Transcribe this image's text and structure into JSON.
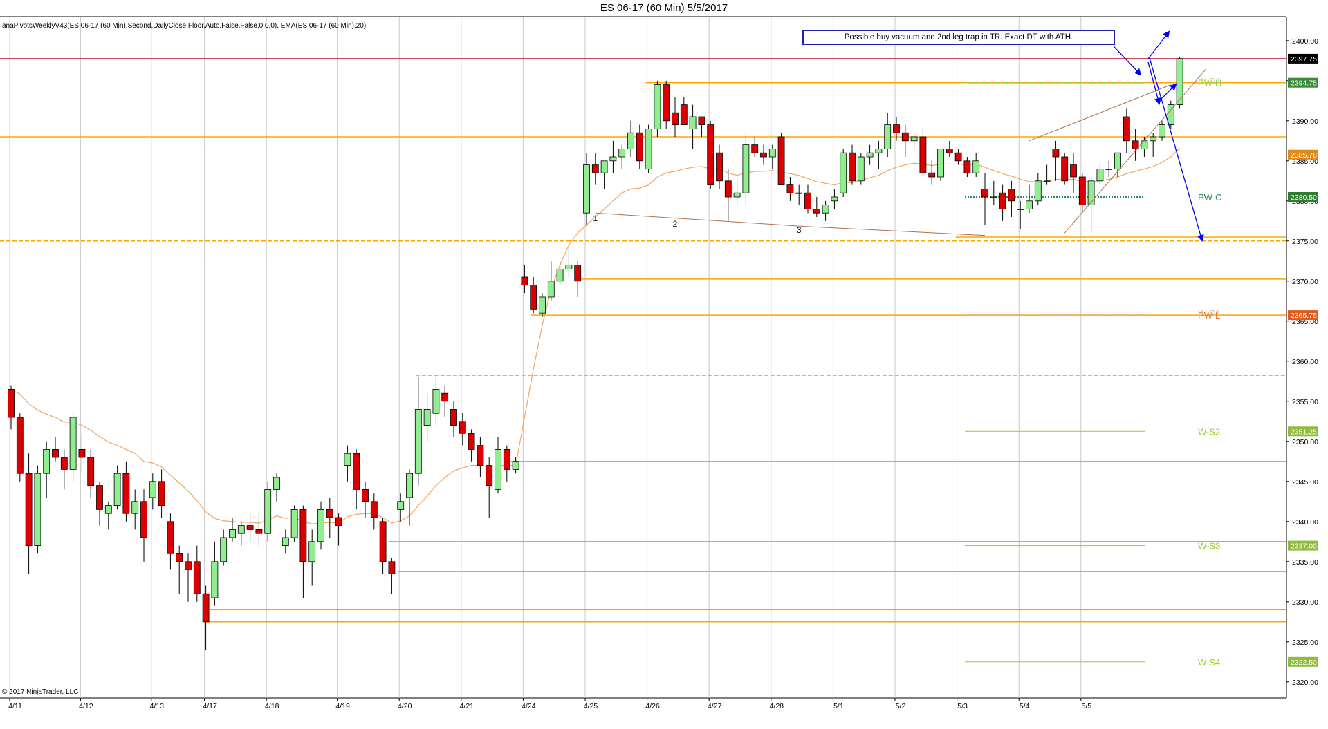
{
  "header": {
    "title": "ES 06-17 (60 Min)  5/5/2017",
    "indicator_label": "anaPivotsWeeklyV43(ES 06-17 (60 Min),Second,DailyClose,Floor,Auto,False,False,0,0,0), EMA(ES 06-17 (60 Min),20)",
    "copyright": "© 2017 NinjaTrader, LLC"
  },
  "annotation": {
    "note": "Possible buy vacuum and 2nd leg trap in TR.  Exact DT with ATH.",
    "swing_labels": [
      "1",
      "2",
      "3"
    ]
  },
  "colors": {
    "up_candle": "#90ee90",
    "down_candle": "#dd0000",
    "ema": "#f4a460",
    "level_line": "#ffa500",
    "pivot_label": "#9acd32",
    "arrow": "#0000ee",
    "pw_c_label": "#2e8b57",
    "last_price_badge": "#000000"
  },
  "chart_data": {
    "type": "candlestick",
    "title": "ES 06-17 (60 Min)  5/5/2017",
    "ylim": [
      2318,
      2403
    ],
    "y_ticks": [
      2320,
      2325,
      2330,
      2335,
      2340,
      2345,
      2350,
      2355,
      2360,
      2365,
      2370,
      2375,
      2380,
      2385,
      2390,
      2395,
      2400
    ],
    "y_tick_labels": [
      "2320.00",
      "2325.00",
      "2330.00",
      "2335.00",
      "2340.00",
      "2345.00",
      "2350.00",
      "2355.00",
      "2360.00",
      "2365.00",
      "2370.00",
      "2375.00",
      "2380.00",
      "2385.00",
      "2390.00",
      "2395.00",
      "2400.00"
    ],
    "x_labels": [
      "4/11",
      "4/12",
      "4/13",
      "4/17",
      "4/18",
      "4/19",
      "4/20",
      "4/21",
      "4/24",
      "4/25",
      "4/26",
      "4/27",
      "4/28",
      "5/1",
      "5/2",
      "5/3",
      "5/4",
      "5/5"
    ],
    "grid": "vertical session separators",
    "candles": [
      [
        2356.5,
        2357.0,
        2351.5,
        2353.0
      ],
      [
        2353.0,
        2353.5,
        2345.0,
        2346.0
      ],
      [
        2346.0,
        2348.5,
        2333.5,
        2337.0
      ],
      [
        2337.0,
        2347.0,
        2336.0,
        2346.0
      ],
      [
        2346.0,
        2350.0,
        2343.0,
        2349.0
      ],
      [
        2349.0,
        2350.5,
        2347.5,
        2348.0
      ],
      [
        2348.0,
        2349.0,
        2344.0,
        2346.5
      ],
      [
        2346.5,
        2353.5,
        2345.0,
        2353.0
      ],
      [
        2349.0,
        2351.0,
        2346.0,
        2348.0
      ],
      [
        2348.0,
        2349.0,
        2343.0,
        2344.5
      ],
      [
        2344.5,
        2345.0,
        2339.5,
        2341.5
      ],
      [
        2341.0,
        2342.5,
        2339.0,
        2342.0
      ],
      [
        2342.0,
        2347.0,
        2341.5,
        2346.0
      ],
      [
        2346.0,
        2347.5,
        2340.0,
        2341.0
      ],
      [
        2341.0,
        2344.0,
        2339.0,
        2342.5
      ],
      [
        2342.5,
        2344.0,
        2335.0,
        2338.0
      ],
      [
        2343.0,
        2346.0,
        2341.5,
        2345.0
      ],
      [
        2345.0,
        2346.5,
        2340.5,
        2342.0
      ],
      [
        2340.0,
        2341.0,
        2334.0,
        2336.0
      ],
      [
        2336.0,
        2337.0,
        2331.0,
        2335.0
      ],
      [
        2335.0,
        2336.0,
        2330.0,
        2334.0
      ],
      [
        2335.0,
        2337.0,
        2330.0,
        2331.0
      ],
      [
        2331.0,
        2332.0,
        2324.0,
        2327.5
      ],
      [
        2330.5,
        2337.5,
        2329.5,
        2335.0
      ],
      [
        2335.0,
        2339.0,
        2334.5,
        2338.0
      ],
      [
        2338.0,
        2340.5,
        2337.5,
        2339.0
      ],
      [
        2338.5,
        2340.0,
        2337.0,
        2339.5
      ],
      [
        2339.5,
        2341.0,
        2337.5,
        2339.0
      ],
      [
        2339.0,
        2341.0,
        2337.0,
        2338.5
      ],
      [
        2338.5,
        2345.0,
        2337.5,
        2344.0
      ],
      [
        2344.0,
        2346.0,
        2342.5,
        2345.5
      ],
      [
        2337.0,
        2339.0,
        2336.0,
        2338.0
      ],
      [
        2338.0,
        2342.0,
        2337.5,
        2341.5
      ],
      [
        2341.5,
        2342.0,
        2330.5,
        2335.0
      ],
      [
        2335.0,
        2339.0,
        2332.0,
        2337.5
      ],
      [
        2337.5,
        2342.5,
        2336.5,
        2341.5
      ],
      [
        2341.5,
        2343.0,
        2338.0,
        2340.5
      ],
      [
        2340.5,
        2341.0,
        2337.0,
        2339.5
      ],
      [
        2347.0,
        2349.5,
        2345.0,
        2348.5
      ],
      [
        2348.5,
        2349.0,
        2341.5,
        2344.0
      ],
      [
        2344.0,
        2345.0,
        2340.5,
        2342.5
      ],
      [
        2342.5,
        2343.5,
        2339.0,
        2340.5
      ],
      [
        2340.0,
        2340.5,
        2333.5,
        2335.0
      ],
      [
        2335.0,
        2335.5,
        2331.0,
        2333.5
      ],
      [
        2341.5,
        2343.5,
        2340.0,
        2342.5
      ],
      [
        2343.0,
        2346.5,
        2339.5,
        2346.0
      ],
      [
        2346.0,
        2358.0,
        2344.5,
        2354.0
      ],
      [
        2352.0,
        2356.0,
        2350.0,
        2354.0
      ],
      [
        2353.5,
        2358.0,
        2352.0,
        2356.5
      ],
      [
        2356.0,
        2357.0,
        2353.0,
        2355.0
      ],
      [
        2354.0,
        2355.0,
        2350.5,
        2352.0
      ],
      [
        2352.5,
        2353.5,
        2349.5,
        2351.0
      ],
      [
        2351.0,
        2351.5,
        2347.5,
        2349.0
      ],
      [
        2349.5,
        2350.5,
        2345.5,
        2347.0
      ],
      [
        2347.0,
        2348.0,
        2340.5,
        2344.5
      ],
      [
        2344.0,
        2350.5,
        2343.5,
        2349.0
      ],
      [
        2349.0,
        2349.5,
        2345.0,
        2346.5
      ],
      [
        2346.5,
        2348.0,
        2346.0,
        2347.5
      ],
      [
        2370.5,
        2372.0,
        2368.5,
        2369.5
      ],
      [
        2369.5,
        2370.5,
        2366.0,
        2366.5
      ],
      [
        2366.0,
        2368.5,
        2365.5,
        2368.0
      ],
      [
        2368.0,
        2372.5,
        2367.5,
        2370.0
      ],
      [
        2370.0,
        2372.5,
        2369.5,
        2371.5
      ],
      [
        2371.5,
        2374.0,
        2370.5,
        2372.0
      ],
      [
        2372.0,
        2372.5,
        2368.0,
        2370.0
      ],
      [
        2378.5,
        2386.0,
        2377.0,
        2384.5
      ],
      [
        2384.5,
        2386.0,
        2382.0,
        2383.5
      ],
      [
        2383.5,
        2385.0,
        2381.5,
        2385.0
      ],
      [
        2385.0,
        2387.5,
        2383.5,
        2385.5
      ],
      [
        2385.5,
        2387.0,
        2384.0,
        2386.5
      ],
      [
        2386.5,
        2390.0,
        2385.5,
        2388.5
      ],
      [
        2388.5,
        2389.5,
        2384.0,
        2385.0
      ],
      [
        2384.0,
        2389.5,
        2383.5,
        2389.0
      ],
      [
        2389.0,
        2395.0,
        2388.0,
        2394.5
      ],
      [
        2394.5,
        2395.0,
        2389.0,
        2390.0
      ],
      [
        2391.0,
        2393.0,
        2388.0,
        2389.5
      ],
      [
        2392.0,
        2393.0,
        2389.5,
        2389.5
      ],
      [
        2389.0,
        2392.0,
        2386.5,
        2390.5
      ],
      [
        2390.5,
        2390.5,
        2388.0,
        2389.5
      ],
      [
        2389.5,
        2390.0,
        2381.5,
        2382.0
      ],
      [
        2386.0,
        2387.0,
        2381.5,
        2382.5
      ],
      [
        2382.5,
        2384.0,
        2377.5,
        2380.5
      ],
      [
        2380.5,
        2383.0,
        2379.5,
        2381.0
      ],
      [
        2381.0,
        2388.5,
        2379.5,
        2387.0
      ],
      [
        2387.0,
        2388.0,
        2385.5,
        2386.0
      ],
      [
        2386.0,
        2387.0,
        2384.5,
        2385.5
      ],
      [
        2385.5,
        2387.0,
        2384.0,
        2386.5
      ],
      [
        2388.0,
        2388.5,
        2382.0,
        2382.0
      ],
      [
        2382.0,
        2383.0,
        2380.0,
        2381.0
      ],
      [
        2381.0,
        2382.0,
        2379.5,
        2381.0
      ],
      [
        2381.0,
        2382.0,
        2378.5,
        2379.0
      ],
      [
        2379.0,
        2380.5,
        2378.0,
        2378.5
      ],
      [
        2378.5,
        2380.0,
        2377.5,
        2379.5
      ],
      [
        2380.0,
        2381.5,
        2379.0,
        2380.5
      ],
      [
        2381.0,
        2386.5,
        2380.5,
        2386.0
      ],
      [
        2386.0,
        2387.0,
        2382.0,
        2382.5
      ],
      [
        2382.5,
        2386.0,
        2382.0,
        2385.5
      ],
      [
        2385.5,
        2387.0,
        2384.5,
        2386.0
      ],
      [
        2386.0,
        2387.5,
        2384.0,
        2386.5
      ],
      [
        2386.5,
        2391.0,
        2385.5,
        2389.5
      ],
      [
        2389.5,
        2390.5,
        2387.5,
        2388.5
      ],
      [
        2388.5,
        2389.5,
        2385.5,
        2387.5
      ],
      [
        2387.5,
        2388.5,
        2386.5,
        2388.0
      ],
      [
        2388.0,
        2389.0,
        2383.0,
        2383.5
      ],
      [
        2383.5,
        2385.0,
        2382.0,
        2383.0
      ],
      [
        2383.0,
        2386.5,
        2382.5,
        2386.5
      ],
      [
        2386.5,
        2387.5,
        2385.5,
        2386.0
      ],
      [
        2386.0,
        2386.5,
        2384.5,
        2385.0
      ],
      [
        2385.0,
        2385.5,
        2383.0,
        2383.5
      ],
      [
        2383.5,
        2386.0,
        2383.0,
        2385.0
      ],
      [
        2381.5,
        2383.5,
        2377.0,
        2380.5
      ],
      [
        2380.5,
        2382.5,
        2379.5,
        2380.5
      ],
      [
        2381.0,
        2382.0,
        2377.5,
        2379.0
      ],
      [
        2381.5,
        2382.5,
        2378.0,
        2380.0
      ],
      [
        2379.0,
        2380.0,
        2376.5,
        2379.0
      ],
      [
        2379.0,
        2382.0,
        2378.5,
        2380.0
      ],
      [
        2380.0,
        2383.5,
        2379.5,
        2382.5
      ],
      [
        2382.5,
        2384.5,
        2382.0,
        2382.5
      ],
      [
        2386.5,
        2387.5,
        2382.5,
        2385.5
      ],
      [
        2385.5,
        2386.0,
        2382.0,
        2382.5
      ],
      [
        2384.5,
        2386.0,
        2381.0,
        2383.0
      ],
      [
        2383.0,
        2383.5,
        2378.5,
        2379.5
      ],
      [
        2379.5,
        2383.0,
        2376.0,
        2382.5
      ],
      [
        2382.5,
        2384.5,
        2382.0,
        2384.0
      ],
      [
        2384.0,
        2385.0,
        2383.0,
        2384.0
      ],
      [
        2384.0,
        2386.0,
        2383.0,
        2386.0
      ],
      [
        2390.5,
        2391.5,
        2386.0,
        2387.5
      ],
      [
        2387.5,
        2389.0,
        2385.0,
        2386.5
      ],
      [
        2386.5,
        2388.0,
        2385.5,
        2387.5
      ],
      [
        2387.5,
        2388.5,
        2385.5,
        2388.0
      ],
      [
        2388.0,
        2390.0,
        2387.5,
        2389.5
      ],
      [
        2389.5,
        2392.5,
        2389.0,
        2392.0
      ],
      [
        2392.0,
        2398.0,
        2391.5,
        2397.75
      ]
    ],
    "session_starts": [
      0,
      8,
      16,
      22,
      29,
      37,
      44,
      51,
      58,
      65,
      72,
      79,
      86,
      93,
      100,
      107,
      114,
      121
    ],
    "ema": [
      2356.5,
      2355.9,
      2354.7,
      2353.9,
      2353.4,
      2353.0,
      2352.4,
      2352.4,
      2352.0,
      2351.4,
      2350.6,
      2349.9,
      2349.5,
      2349.0,
      2348.5,
      2347.5,
      2347.3,
      2346.8,
      2345.8,
      2344.8,
      2343.8,
      2342.6,
      2341.2,
      2340.4,
      2340.1,
      2340.0,
      2339.9,
      2339.9,
      2339.8,
      2340.2,
      2340.7,
      2340.4,
      2340.5,
      2340.0,
      2339.7,
      2339.8,
      2339.9,
      2339.8,
      2340.6,
      2340.9,
      2341.0,
      2341.0,
      2340.5,
      2339.8,
      2340.1,
      2340.7,
      2342.0,
      2343.2,
      2344.5,
      2345.5,
      2346.3,
      2346.7,
      2347.0,
      2347.0,
      2346.8,
      2347.0,
      2347.0,
      2347.0,
      2353.0,
      2359.0,
      2364.5,
      2369.0,
      2372.0,
      2374.5,
      2376.0,
      2377.0,
      2378.0,
      2379.0,
      2380.0,
      2381.0,
      2381.5,
      2381.6,
      2382.0,
      2383.0,
      2383.5,
      2383.7,
      2384.0,
      2384.2,
      2384.3,
      2384.0,
      2384.0,
      2383.5,
      2383.2,
      2383.5,
      2383.7,
      2383.7,
      2383.8,
      2383.6,
      2383.4,
      2383.2,
      2382.8,
      2382.4,
      2382.2,
      2382.0,
      2382.3,
      2382.3,
      2382.6,
      2382.9,
      2383.2,
      2383.8,
      2384.2,
      2384.5,
      2384.7,
      2384.6,
      2384.4,
      2384.6,
      2384.6,
      2384.6,
      2384.5,
      2384.6,
      2384.2,
      2383.8,
      2383.4,
      2383.1,
      2382.7,
      2382.4,
      2382.4,
      2382.4,
      2382.7,
      2382.7,
      2382.7,
      2382.4,
      2382.4,
      2382.5,
      2382.7,
      2383.0,
      2383.4,
      2383.7,
      2384.0,
      2384.3,
      2384.8,
      2385.5,
      2386.6
    ],
    "horizontal_levels": [
      {
        "price": 2397.75,
        "style": "solid",
        "color": "#c0304f",
        "from_bar": 0
      },
      {
        "price": 2394.75,
        "style": "solid",
        "color": "#ffa500",
        "from_bar": 72
      },
      {
        "price": 2388.0,
        "style": "solid",
        "color": "#ffa500",
        "from_bar": 0
      },
      {
        "price": 2375.0,
        "style": "dashed",
        "color": "#ffa500",
        "from_bar": 0
      },
      {
        "price": 2375.5,
        "style": "solid",
        "color": "#ffa500",
        "from_bar": 107
      },
      {
        "price": 2370.25,
        "style": "solid",
        "color": "#ffa500",
        "from_bar": 64
      },
      {
        "price": 2365.75,
        "style": "solid",
        "color": "#ffa500",
        "from_bar": 59
      },
      {
        "price": 2358.25,
        "style": "dashed",
        "color": "#ffa500",
        "from_bar": 46
      },
      {
        "price": 2347.5,
        "style": "solid",
        "color": "#ffa500",
        "from_bar": 56
      },
      {
        "price": 2337.5,
        "style": "solid",
        "color": "#ffa500",
        "from_bar": 43
      },
      {
        "price": 2333.75,
        "style": "solid",
        "color": "#ffa500",
        "from_bar": 44
      },
      {
        "price": 2329.0,
        "style": "solid",
        "color": "#ffa500",
        "from_bar": 22
      },
      {
        "price": 2327.5,
        "style": "solid",
        "color": "#ffa500",
        "from_bar": 22
      }
    ],
    "pivot_labels": [
      {
        "label": "PW-H",
        "price": 2394.75,
        "color": "#9acd32"
      },
      {
        "label": "W-R1",
        "price": 2395.0,
        "color": "#c8dca0"
      },
      {
        "label": "PW-C",
        "price": 2380.5,
        "color": "#2e8b57"
      },
      {
        "label": "PW-L",
        "price": 2365.75,
        "color": "#e07820"
      },
      {
        "label": "W-S1",
        "price": 2366.0,
        "color": "#d8c0a0"
      },
      {
        "label": "W-S2",
        "price": 2351.25,
        "color": "#9acd32"
      },
      {
        "label": "W-S3",
        "price": 2337.0,
        "color": "#9acd32"
      },
      {
        "label": "W-S4",
        "price": 2322.5,
        "color": "#9acd32"
      }
    ],
    "price_badges": [
      {
        "text": "2397.75",
        "price": 2397.75,
        "color": "#000000"
      },
      {
        "text": "2394.75",
        "price": 2394.75,
        "color": "#3a8a3a"
      },
      {
        "text": "2385.78",
        "price": 2385.78,
        "color": "#e08a1a"
      },
      {
        "text": "2380.50",
        "price": 2380.5,
        "color": "#2e7d32"
      },
      {
        "text": "2365.75",
        "price": 2365.75,
        "color": "#e05a1a"
      },
      {
        "text": "2351.25",
        "price": 2351.25,
        "color": "#8fbc3f"
      },
      {
        "text": "2337.00",
        "price": 2337.0,
        "color": "#8fbc3f"
      },
      {
        "text": "2322.50",
        "price": 2322.5,
        "color": "#8fbc3f"
      }
    ]
  }
}
